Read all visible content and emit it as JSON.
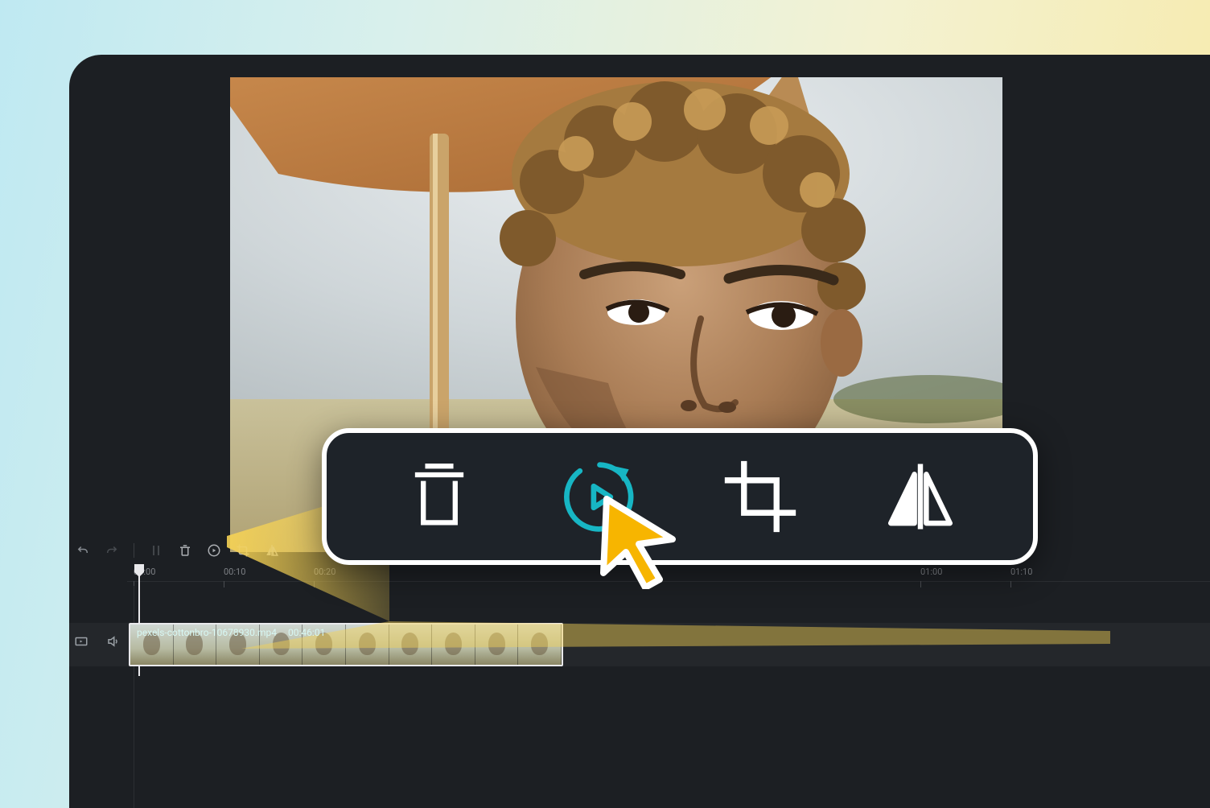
{
  "clip": {
    "filename": "pexels-cottonbro-10678930.mp4",
    "duration": "00:46:01"
  },
  "ruler": {
    "marks": [
      "00:00",
      "00:10",
      "00:20",
      "01:00",
      "01:10"
    ]
  },
  "toolbar_small": {
    "icons": [
      "undo",
      "redo",
      "split",
      "delete",
      "speed",
      "crop",
      "mirror"
    ]
  },
  "callout": {
    "icons": [
      "delete",
      "speed",
      "crop",
      "mirror"
    ],
    "highlighted_index": 1
  },
  "colors": {
    "accent": "#17b6c4",
    "cursor": "#f7b500"
  }
}
